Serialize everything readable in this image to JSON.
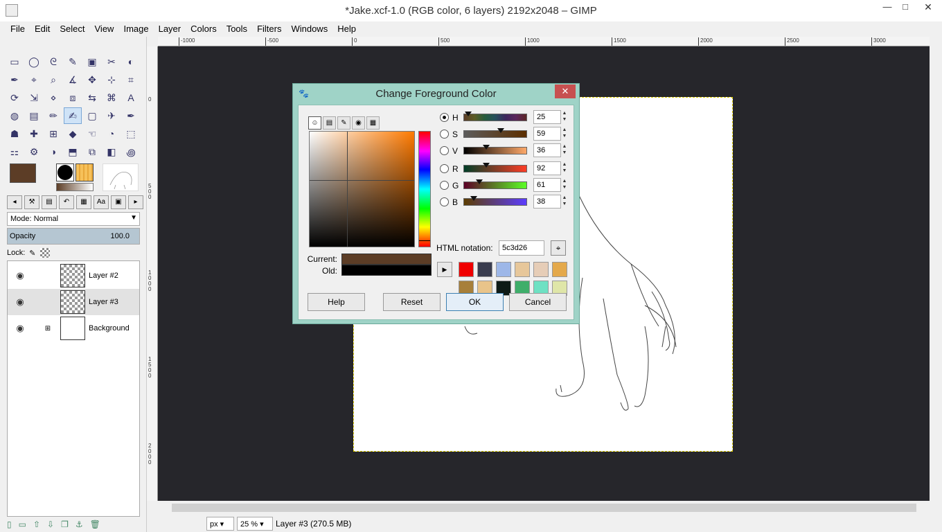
{
  "window": {
    "title": "*Jake.xcf-1.0 (RGB color, 6 layers) 2192x2048 – GIMP",
    "minimize": "—",
    "maximize": "□",
    "close": "✕"
  },
  "menu": [
    "File",
    "Edit",
    "Select",
    "View",
    "Image",
    "Layer",
    "Colors",
    "Tools",
    "Filters",
    "Windows",
    "Help"
  ],
  "toolbox": {
    "tools": [
      "rect-select",
      "ellipse-select",
      "free-select",
      "fuzzy-select",
      "by-color-select",
      "scissors-select",
      "foreground-select",
      "paths",
      "color-picker",
      "zoom",
      "measure",
      "move",
      "alignment",
      "crop",
      "rotate",
      "scale",
      "shear",
      "perspective",
      "flip",
      "cage",
      "text",
      "bucket-fill",
      "blend",
      "pencil",
      "paintbrush",
      "eraser",
      "airbrush",
      "ink",
      "clone",
      "heal",
      "perspective-clone",
      "blur",
      "smudge",
      "dodge-burn",
      "unified-transform",
      "warp",
      "handle-transform",
      "mypaint",
      "n-point",
      "seamless-clone",
      "gegl",
      "spiral"
    ],
    "tool_glyphs": [
      "▭",
      "◯",
      "ᘓ",
      "✎",
      "▣",
      "✂",
      "◐",
      "✒",
      "⌖",
      "⌕",
      "∡",
      "✥",
      "⊹",
      "⌗",
      "⟳",
      "⇲",
      "⋄",
      "⧈",
      "⇆",
      "⌘",
      "A",
      "◍",
      "▤",
      "✏",
      "✍",
      "▢",
      "✈",
      "✒",
      "☗",
      "✚",
      "⊞",
      "◆",
      "☜",
      "◔",
      "⬚",
      "⚏",
      "⚙",
      "◑",
      "⬒",
      "⧉",
      "◧",
      "꩜"
    ],
    "active_tool_index": 24,
    "foreground_color": "#5c3d26",
    "background_color": "#000000",
    "option_tabs": [
      "◂",
      "⚒",
      "▤",
      "↶",
      "▦",
      "Aa",
      "▣",
      "▸"
    ],
    "mode_label": "Mode: Normal",
    "opacity_label": "Opacity",
    "opacity_value": "100.0",
    "lock_label": "Lock:",
    "layers": [
      {
        "name": "Layer #2",
        "visible": true,
        "selected": false,
        "type": "transparent"
      },
      {
        "name": "Layer #3",
        "visible": true,
        "selected": true,
        "type": "transparent"
      },
      {
        "name": "Background",
        "visible": true,
        "selected": false,
        "type": "white"
      }
    ],
    "layer_buttons": [
      "▯",
      "▭",
      "⇧",
      "⇩",
      "❐",
      "⚓",
      "🗑"
    ]
  },
  "ruler": {
    "top_labels": [
      "-1000",
      "-500",
      "0",
      "500",
      "1000",
      "1500",
      "2000",
      "2500",
      "3000"
    ],
    "left_labels": [
      "0",
      "5\n0\n0",
      "1\n0\n0\n0",
      "1\n5\n0\n0",
      "2\n0\n0\n0"
    ]
  },
  "status": {
    "unit": "px",
    "zoom": "25 %",
    "text": "Layer #3 (270.5 MB)"
  },
  "dialog": {
    "title": "Change Foreground Color",
    "close": "✕",
    "selector_tabs": [
      "☺",
      "▤",
      "✎",
      "◉",
      "▦"
    ],
    "current_label": "Current:",
    "old_label": "Old:",
    "current_color": "#5c3d26",
    "old_color": "#000000",
    "channels": [
      {
        "label": "H",
        "value": "25",
        "fraction": 0.07,
        "selected": true,
        "gradient": "linear-gradient(90deg,#5c3d26,#5c5c26,#265c3d,#26505c,#3d265c,#5c265c,#5c2626)"
      },
      {
        "label": "S",
        "value": "59",
        "fraction": 0.59,
        "selected": false,
        "gradient": "linear-gradient(90deg,#5c5c5c,#5c2e00)"
      },
      {
        "label": "V",
        "value": "36",
        "fraction": 0.36,
        "selected": false,
        "gradient": "linear-gradient(90deg,#000,#ffa96a)"
      },
      {
        "label": "R",
        "value": "92",
        "fraction": 0.36,
        "selected": false,
        "gradient": "linear-gradient(90deg,#003d26,#ff3d26)"
      },
      {
        "label": "G",
        "value": "61",
        "fraction": 0.24,
        "selected": false,
        "gradient": "linear-gradient(90deg,#5c0026,#5cff26)"
      },
      {
        "label": "B",
        "value": "38",
        "fraction": 0.15,
        "selected": false,
        "gradient": "linear-gradient(90deg,#5c3d00,#5c3dff)"
      }
    ],
    "html_label": "HTML notation:",
    "html_value": "5c3d26",
    "history_colors": [
      "#f00000",
      "#3a3d4f",
      "#9db7e8",
      "#e7c79a",
      "#e6cdb7",
      "#e4a94b",
      "#a77f3a",
      "#e9c48a",
      "#0e1a16",
      "#3fae6a",
      "#6ee1c3",
      "#dfe6a8"
    ],
    "buttons": {
      "help": "Help",
      "reset": "Reset",
      "ok": "OK",
      "cancel": "Cancel"
    }
  }
}
